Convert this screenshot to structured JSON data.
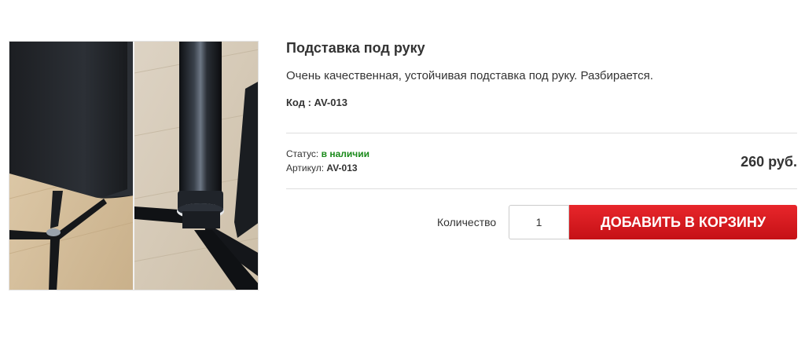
{
  "product": {
    "title": "Подставка под руку",
    "description": "Очень качественная, устойчивая подставка под руку. Разбирается.",
    "code_label": "Код :",
    "code_value": "AV-013",
    "status_label": "Статус:",
    "status_value": "в наличии",
    "sku_label": "Артикул:",
    "sku_value": "AV-013",
    "price": "260 руб."
  },
  "purchase": {
    "quantity_label": "Количество",
    "quantity_value": "1",
    "add_to_cart_label": "ДОБАВИТЬ В КОРЗИНУ"
  },
  "colors": {
    "accent_red": "#d71a20",
    "status_green": "#1a8a1a",
    "text": "#333333"
  }
}
